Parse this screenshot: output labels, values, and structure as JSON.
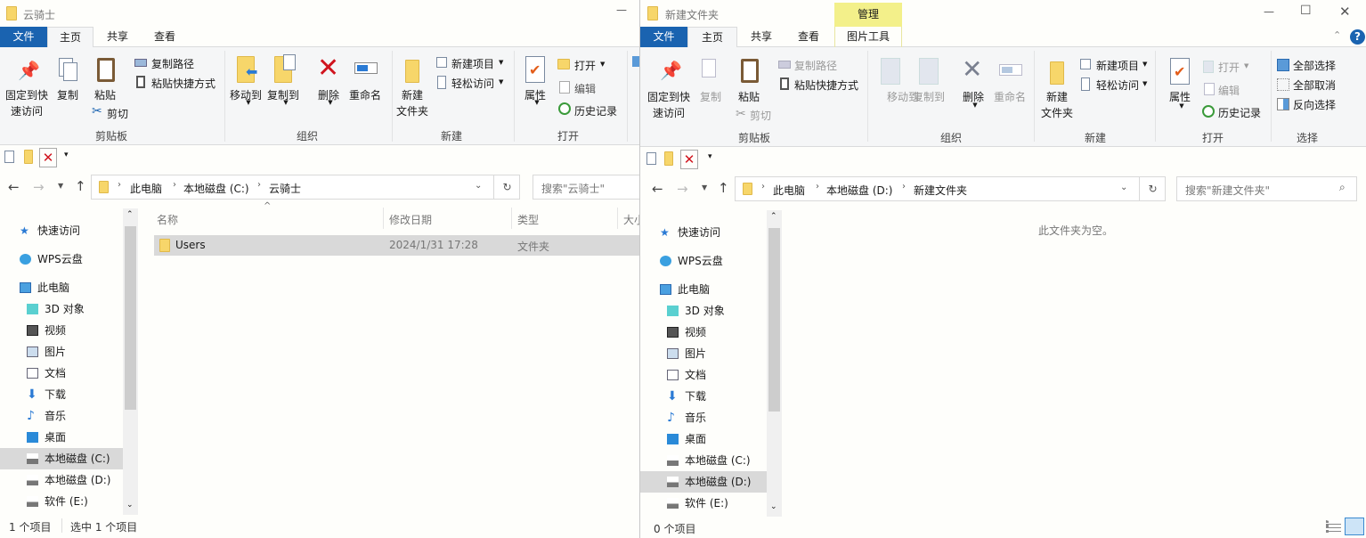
{
  "left": {
    "title": "云骑士",
    "tabs": {
      "file": "文件",
      "home": "主页",
      "share": "共享",
      "view": "查看"
    },
    "ribbon": {
      "pin1": "固定到快",
      "pin2": "速访问",
      "copy": "复制",
      "paste": "粘贴",
      "cut": "剪切",
      "copy_path": "复制路径",
      "paste_shortcut": "粘贴快捷方式",
      "move_to": "移动到",
      "copy_to": "复制到",
      "delete": "删除",
      "rename": "重命名",
      "new_folder1": "新建",
      "new_folder2": "文件夹",
      "new_item": "新建项目",
      "easy_access": "轻松访问",
      "properties": "属性",
      "open": "打开",
      "edit": "编辑",
      "history": "历史记录",
      "groups": {
        "clipboard": "剪贴板",
        "organize": "组织",
        "new": "新建",
        "open": "打开"
      }
    },
    "breadcrumb": [
      "此电脑",
      "本地磁盘 (C:)",
      "云骑士"
    ],
    "search_placeholder": "搜索\"云骑士\"",
    "columns": {
      "name": "名称",
      "date": "修改日期",
      "type": "类型",
      "size": "大小"
    },
    "files": [
      {
        "name": "Users",
        "date": "2024/1/31 17:28",
        "type": "文件夹"
      }
    ],
    "nav": [
      "快速访问",
      "WPS云盘",
      "此电脑",
      "3D 对象",
      "视频",
      "图片",
      "文档",
      "下载",
      "音乐",
      "桌面",
      "本地磁盘 (C:)",
      "本地磁盘 (D:)",
      "软件 (E:)"
    ],
    "nav_selected": "本地磁盘 (C:)",
    "status": {
      "count": "1 个项目",
      "selected": "选中 1 个项目"
    }
  },
  "right": {
    "title": "新建文件夹",
    "contextual_tab": "管理",
    "tabs": {
      "file": "文件",
      "home": "主页",
      "share": "共享",
      "view": "查看",
      "picture_tools": "图片工具"
    },
    "ribbon": {
      "pin1": "固定到快",
      "pin2": "速访问",
      "copy": "复制",
      "paste": "粘贴",
      "cut": "剪切",
      "copy_path": "复制路径",
      "paste_shortcut": "粘贴快捷方式",
      "move_to": "移动到",
      "copy_to": "复制到",
      "delete": "删除",
      "rename": "重命名",
      "new_folder1": "新建",
      "new_folder2": "文件夹",
      "new_item": "新建项目",
      "easy_access": "轻松访问",
      "properties": "属性",
      "open": "打开",
      "edit": "编辑",
      "history": "历史记录",
      "select_all": "全部选择",
      "select_none": "全部取消",
      "invert": "反向选择",
      "groups": {
        "clipboard": "剪贴板",
        "organize": "组织",
        "new": "新建",
        "open": "打开",
        "select": "选择"
      }
    },
    "breadcrumb": [
      "此电脑",
      "本地磁盘 (D:)",
      "新建文件夹"
    ],
    "search_placeholder": "搜索\"新建文件夹\"",
    "empty_message": "此文件夹为空。",
    "nav": [
      "快速访问",
      "WPS云盘",
      "此电脑",
      "3D 对象",
      "视频",
      "图片",
      "文档",
      "下载",
      "音乐",
      "桌面",
      "本地磁盘 (C:)",
      "本地磁盘 (D:)",
      "软件 (E:)"
    ],
    "nav_selected": "本地磁盘 (D:)",
    "status": {
      "count": "0 个项目"
    }
  },
  "colors": {
    "file_tab": "#1a63b0",
    "contextual_tab": "#f3f08a",
    "selection": "#d9d9d9",
    "delete_red": "#d0141e"
  }
}
